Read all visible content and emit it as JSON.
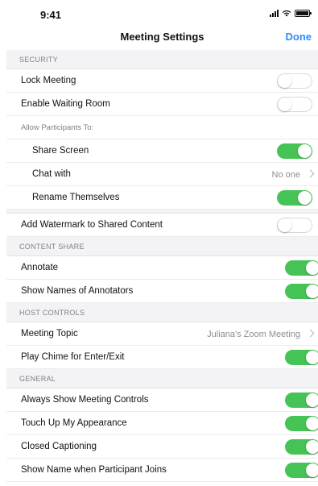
{
  "status_bar": {
    "time": "9:41"
  },
  "nav": {
    "title": "Meeting Settings",
    "done_label": "Done"
  },
  "security": {
    "header": "SECURITY",
    "lock_meeting": {
      "label": "Lock Meeting",
      "enabled": false
    },
    "waiting_room": {
      "label": "Enable Waiting Room",
      "enabled": false
    },
    "allow_header": "Allow Participants To:",
    "share_screen": {
      "label": "Share Screen",
      "enabled": true
    },
    "chat_with": {
      "label": "Chat with",
      "value": "No one"
    },
    "rename": {
      "label": "Rename Themselves",
      "enabled": true
    },
    "watermark": {
      "label": "Add Watermark to Shared Content",
      "enabled": false
    }
  },
  "content_share": {
    "header": "CONTENT SHARE",
    "annotate": {
      "label": "Annotate",
      "enabled": true
    },
    "show_names": {
      "label": "Show Names of Annotators",
      "enabled": true
    }
  },
  "host_controls": {
    "header": "HOST CONTROLS",
    "meeting_topic": {
      "label": "Meeting Topic",
      "value": "Juliana's Zoom Meeting"
    },
    "play_chime": {
      "label": "Play Chime for Enter/Exit",
      "enabled": true
    }
  },
  "general": {
    "header": "GENERAL",
    "always_show": {
      "label": "Always Show Meeting Controls",
      "enabled": true
    },
    "touch_up": {
      "label": "Touch Up My Appearance",
      "enabled": true
    },
    "captioning": {
      "label": "Closed Captioning",
      "enabled": true
    },
    "show_name_join": {
      "label": "Show Name when Participant Joins",
      "enabled": true
    }
  },
  "colors": {
    "accent": "#2d8cff",
    "toggle_on": "#45c354",
    "section_bg": "#f3f3f5"
  }
}
